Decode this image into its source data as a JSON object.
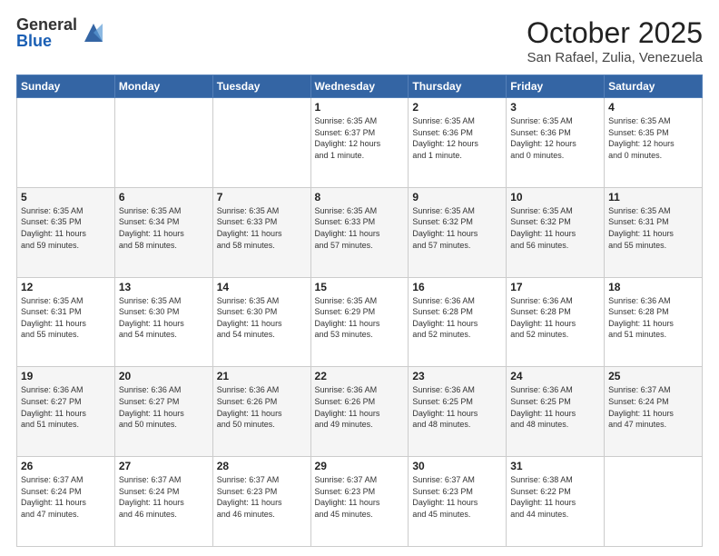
{
  "header": {
    "logo_general": "General",
    "logo_blue": "Blue",
    "month_title": "October 2025",
    "location": "San Rafael, Zulia, Venezuela"
  },
  "weekdays": [
    "Sunday",
    "Monday",
    "Tuesday",
    "Wednesday",
    "Thursday",
    "Friday",
    "Saturday"
  ],
  "weeks": [
    [
      {
        "day": "",
        "info": ""
      },
      {
        "day": "",
        "info": ""
      },
      {
        "day": "",
        "info": ""
      },
      {
        "day": "1",
        "info": "Sunrise: 6:35 AM\nSunset: 6:37 PM\nDaylight: 12 hours\nand 1 minute."
      },
      {
        "day": "2",
        "info": "Sunrise: 6:35 AM\nSunset: 6:36 PM\nDaylight: 12 hours\nand 1 minute."
      },
      {
        "day": "3",
        "info": "Sunrise: 6:35 AM\nSunset: 6:36 PM\nDaylight: 12 hours\nand 0 minutes."
      },
      {
        "day": "4",
        "info": "Sunrise: 6:35 AM\nSunset: 6:35 PM\nDaylight: 12 hours\nand 0 minutes."
      }
    ],
    [
      {
        "day": "5",
        "info": "Sunrise: 6:35 AM\nSunset: 6:35 PM\nDaylight: 11 hours\nand 59 minutes."
      },
      {
        "day": "6",
        "info": "Sunrise: 6:35 AM\nSunset: 6:34 PM\nDaylight: 11 hours\nand 58 minutes."
      },
      {
        "day": "7",
        "info": "Sunrise: 6:35 AM\nSunset: 6:33 PM\nDaylight: 11 hours\nand 58 minutes."
      },
      {
        "day": "8",
        "info": "Sunrise: 6:35 AM\nSunset: 6:33 PM\nDaylight: 11 hours\nand 57 minutes."
      },
      {
        "day": "9",
        "info": "Sunrise: 6:35 AM\nSunset: 6:32 PM\nDaylight: 11 hours\nand 57 minutes."
      },
      {
        "day": "10",
        "info": "Sunrise: 6:35 AM\nSunset: 6:32 PM\nDaylight: 11 hours\nand 56 minutes."
      },
      {
        "day": "11",
        "info": "Sunrise: 6:35 AM\nSunset: 6:31 PM\nDaylight: 11 hours\nand 55 minutes."
      }
    ],
    [
      {
        "day": "12",
        "info": "Sunrise: 6:35 AM\nSunset: 6:31 PM\nDaylight: 11 hours\nand 55 minutes."
      },
      {
        "day": "13",
        "info": "Sunrise: 6:35 AM\nSunset: 6:30 PM\nDaylight: 11 hours\nand 54 minutes."
      },
      {
        "day": "14",
        "info": "Sunrise: 6:35 AM\nSunset: 6:30 PM\nDaylight: 11 hours\nand 54 minutes."
      },
      {
        "day": "15",
        "info": "Sunrise: 6:35 AM\nSunset: 6:29 PM\nDaylight: 11 hours\nand 53 minutes."
      },
      {
        "day": "16",
        "info": "Sunrise: 6:36 AM\nSunset: 6:28 PM\nDaylight: 11 hours\nand 52 minutes."
      },
      {
        "day": "17",
        "info": "Sunrise: 6:36 AM\nSunset: 6:28 PM\nDaylight: 11 hours\nand 52 minutes."
      },
      {
        "day": "18",
        "info": "Sunrise: 6:36 AM\nSunset: 6:28 PM\nDaylight: 11 hours\nand 51 minutes."
      }
    ],
    [
      {
        "day": "19",
        "info": "Sunrise: 6:36 AM\nSunset: 6:27 PM\nDaylight: 11 hours\nand 51 minutes."
      },
      {
        "day": "20",
        "info": "Sunrise: 6:36 AM\nSunset: 6:27 PM\nDaylight: 11 hours\nand 50 minutes."
      },
      {
        "day": "21",
        "info": "Sunrise: 6:36 AM\nSunset: 6:26 PM\nDaylight: 11 hours\nand 50 minutes."
      },
      {
        "day": "22",
        "info": "Sunrise: 6:36 AM\nSunset: 6:26 PM\nDaylight: 11 hours\nand 49 minutes."
      },
      {
        "day": "23",
        "info": "Sunrise: 6:36 AM\nSunset: 6:25 PM\nDaylight: 11 hours\nand 48 minutes."
      },
      {
        "day": "24",
        "info": "Sunrise: 6:36 AM\nSunset: 6:25 PM\nDaylight: 11 hours\nand 48 minutes."
      },
      {
        "day": "25",
        "info": "Sunrise: 6:37 AM\nSunset: 6:24 PM\nDaylight: 11 hours\nand 47 minutes."
      }
    ],
    [
      {
        "day": "26",
        "info": "Sunrise: 6:37 AM\nSunset: 6:24 PM\nDaylight: 11 hours\nand 47 minutes."
      },
      {
        "day": "27",
        "info": "Sunrise: 6:37 AM\nSunset: 6:24 PM\nDaylight: 11 hours\nand 46 minutes."
      },
      {
        "day": "28",
        "info": "Sunrise: 6:37 AM\nSunset: 6:23 PM\nDaylight: 11 hours\nand 46 minutes."
      },
      {
        "day": "29",
        "info": "Sunrise: 6:37 AM\nSunset: 6:23 PM\nDaylight: 11 hours\nand 45 minutes."
      },
      {
        "day": "30",
        "info": "Sunrise: 6:37 AM\nSunset: 6:23 PM\nDaylight: 11 hours\nand 45 minutes."
      },
      {
        "day": "31",
        "info": "Sunrise: 6:38 AM\nSunset: 6:22 PM\nDaylight: 11 hours\nand 44 minutes."
      },
      {
        "day": "",
        "info": ""
      }
    ]
  ]
}
